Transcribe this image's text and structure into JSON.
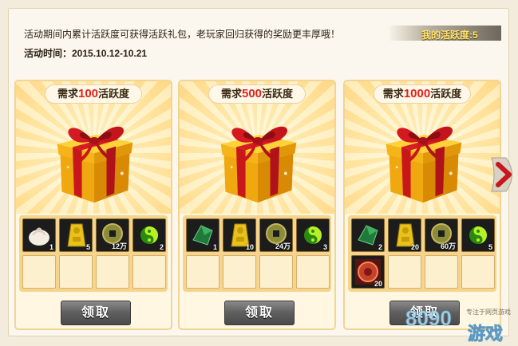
{
  "header": {
    "intro": "活动期间内累计活跃度可获得活跃礼包，老玩家回归获得的奖励更丰厚哦！",
    "time": "活动时间：2015.10.12-10.21",
    "my_activity": "我的活跃度:5"
  },
  "cards": [
    {
      "req_prefix": "需求",
      "req_num": "100",
      "req_suffix": "活跃度",
      "button": "领取",
      "items": [
        {
          "icon": "bun-icon",
          "qty": "1"
        },
        {
          "icon": "gold-token-icon",
          "qty": "5"
        },
        {
          "icon": "coin-icon",
          "qty": "12万"
        },
        {
          "icon": "green-orb-icon",
          "qty": "2"
        }
      ]
    },
    {
      "req_prefix": "需求",
      "req_num": "500",
      "req_suffix": "活跃度",
      "button": "领取",
      "items": [
        {
          "icon": "green-crystal-icon",
          "qty": "1"
        },
        {
          "icon": "gold-token-icon",
          "qty": "10"
        },
        {
          "icon": "coin-icon",
          "qty": "24万"
        },
        {
          "icon": "green-orb-icon",
          "qty": "3"
        }
      ]
    },
    {
      "req_prefix": "需求",
      "req_num": "1000",
      "req_suffix": "活跃度",
      "button": "领取",
      "items": [
        {
          "icon": "green-crystal-icon",
          "qty": "2"
        },
        {
          "icon": "gold-token-icon",
          "qty": "20"
        },
        {
          "icon": "coin-icon",
          "qty": "60万"
        },
        {
          "icon": "green-orb-icon",
          "qty": "5"
        },
        {
          "icon": "red-medallion-icon",
          "qty": "20"
        }
      ]
    }
  ],
  "watermark": {
    "logo": "8090",
    "tagline": "专注于网页游戏",
    "brand": "游戏"
  },
  "colors": {
    "accent_red": "#e0221b",
    "card_border": "#f2d493",
    "button_gray": "#5e5e5e"
  }
}
